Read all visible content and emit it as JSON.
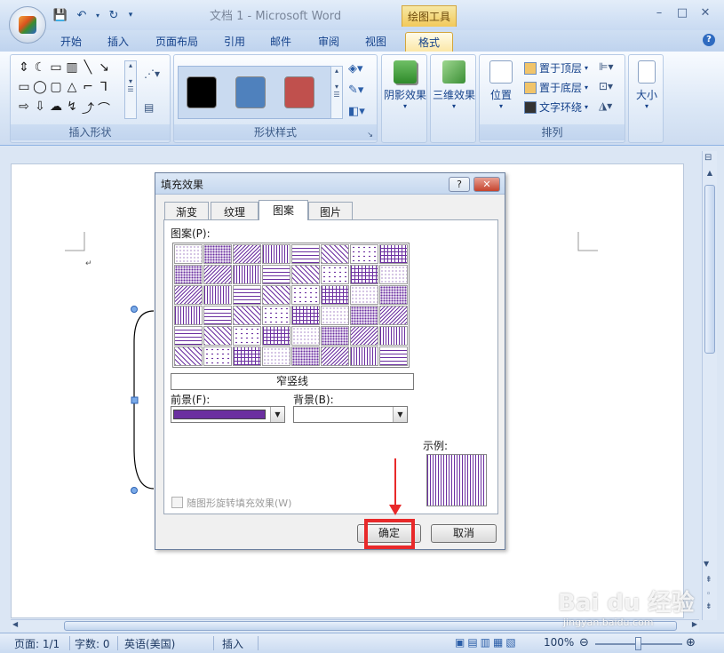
{
  "window": {
    "title": "文档 1 - Microsoft Word",
    "contextual_tab_group": "绘图工具",
    "controls": [
      "–",
      "□",
      "✕"
    ]
  },
  "ribbon_tabs": [
    "开始",
    "插入",
    "页面布局",
    "引用",
    "邮件",
    "审阅",
    "视图",
    "格式"
  ],
  "active_tab": "格式",
  "ribbon": {
    "insert_shapes_label": "插入形状",
    "shape_styles_label": "形状样式",
    "shadow_effects": "阴影效果",
    "3d_effects": "三维效果",
    "position": "位置",
    "bring_to_front": "置于顶层",
    "send_to_back": "置于底层",
    "text_wrapping": "文字环绕",
    "arrange_label": "排列",
    "size": "大小",
    "style_swatches": [
      "#000000",
      "#4f81bd",
      "#c0504d"
    ]
  },
  "dialog": {
    "title": "填充效果",
    "help": "?",
    "close": "✕",
    "tabs": [
      "渐变",
      "纹理",
      "图案",
      "图片"
    ],
    "active_tab": "图案",
    "pattern_label": "图案(P):",
    "selected_pattern_name": "窄竖线",
    "foreground_label": "前景(F):",
    "background_label": "背景(B):",
    "foreground_color": "#6b2fa0",
    "sample_label": "示例:",
    "rotate_checkbox": "随图形旋转填充效果(W)",
    "ok": "确定",
    "cancel": "取消"
  },
  "status_bar": {
    "page": "页面: 1/1",
    "words": "字数: 0",
    "language": "英语(美国)",
    "mode": "插入",
    "zoom": "100%"
  },
  "watermark": {
    "brand": "Bai du 经验",
    "url": "jingyan.baidu.com"
  }
}
